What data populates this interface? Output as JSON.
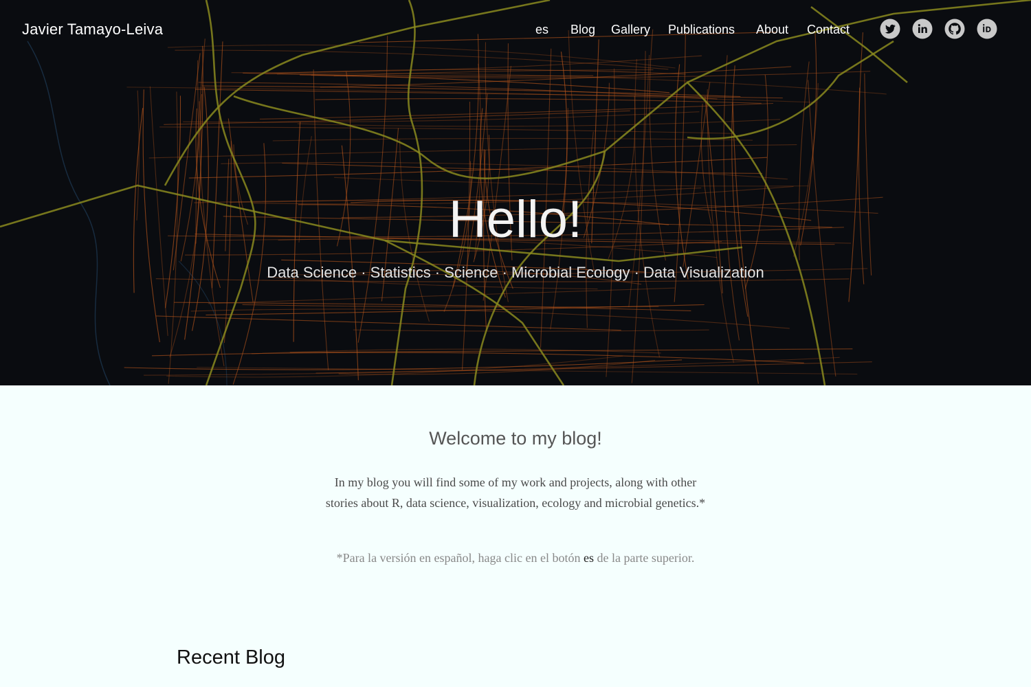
{
  "site": {
    "brand": "Javier Tamayo-Leiva"
  },
  "nav": {
    "items": [
      {
        "label": "es"
      },
      {
        "label": "Blog"
      },
      {
        "label": "Gallery"
      },
      {
        "label": "Publications"
      },
      {
        "label": "About"
      },
      {
        "label": "Contact"
      }
    ],
    "social_icons": [
      "twitter-icon",
      "linkedin-icon",
      "github-icon",
      "orcid-icon"
    ]
  },
  "hero": {
    "title": "Hello!",
    "subtitle": "Data Science · Statistics · Science · Microbial Ecology · Data Visualization",
    "background": "city street map (orange streets, olive highways) on near-black"
  },
  "welcome": {
    "heading": "Welcome to my blog!",
    "intro": "In my blog you will find some of my work and projects, along with other stories about R, data science, visualization, ecology and microbial genetics.",
    "intro_mark": "*",
    "note_mark": "*",
    "note_before": "Para la versión en español, haga clic en el botón ",
    "note_es": "es",
    "note_after": " de la parte superior."
  },
  "recent": {
    "heading": "Recent Blog"
  },
  "colors": {
    "hero_bg": "#0a0c10",
    "street": "#b8561c",
    "highway": "#8a8a1e",
    "river": "#1e3a55",
    "page_bg": "#f5fffe",
    "icon_circle": "#c9c9c9"
  }
}
